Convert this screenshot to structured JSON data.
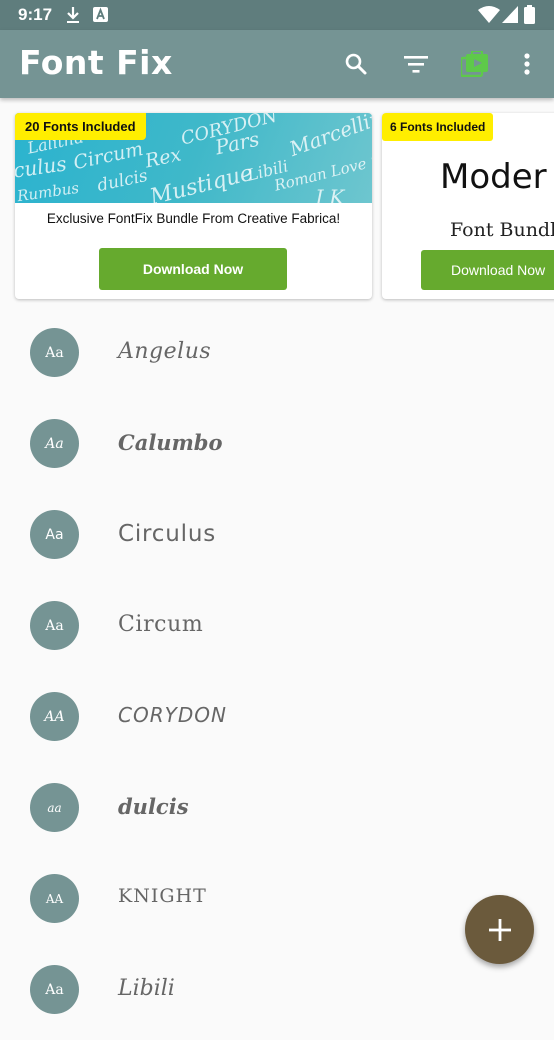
{
  "status_bar": {
    "time": "9:17",
    "icons": [
      "download-icon",
      "app-a-icon",
      "wifi-icon",
      "signal-icon",
      "battery-icon"
    ]
  },
  "app_bar": {
    "title": "Font Fix",
    "actions": [
      "search-icon",
      "filter-icon",
      "bundle-store-icon",
      "more-vert-icon"
    ],
    "accent_color": "#5ec94a"
  },
  "promos": [
    {
      "badge": "20 Fonts Included",
      "banner_words": [
        "CORYDON",
        "Marcellino",
        "Lalitha",
        "culus",
        "Circum",
        "Rex",
        "Pars",
        "dulcis",
        "Libili",
        "Roman Love St",
        "Mustique",
        "Rumbus",
        "J K"
      ],
      "description": "Exclusive FontFix Bundle From Creative Fabrica!",
      "button": "Download Now"
    },
    {
      "badge": "6 Fonts Included",
      "headline": "Moder",
      "subline": "Font Bundle",
      "button": "Download Now"
    }
  ],
  "fonts": [
    {
      "preview": "Aa",
      "name": "Angelus"
    },
    {
      "preview": "Aa",
      "name": "Calumbo"
    },
    {
      "preview": "Aa",
      "name": "Circulus"
    },
    {
      "preview": "Aa",
      "name": "Circum"
    },
    {
      "preview": "AA",
      "name": "CORYDON"
    },
    {
      "preview": "aa",
      "name": "dulcis"
    },
    {
      "preview": "AA",
      "name": "KNIGHT"
    },
    {
      "preview": "Aa",
      "name": "Libili"
    }
  ],
  "fab": {
    "icon": "add-icon"
  },
  "colors": {
    "status_bar": "#5f7d7d",
    "app_bar": "#759494",
    "badge": "#ffee00",
    "button": "#66aa2e",
    "fab": "#6b5a3c"
  }
}
